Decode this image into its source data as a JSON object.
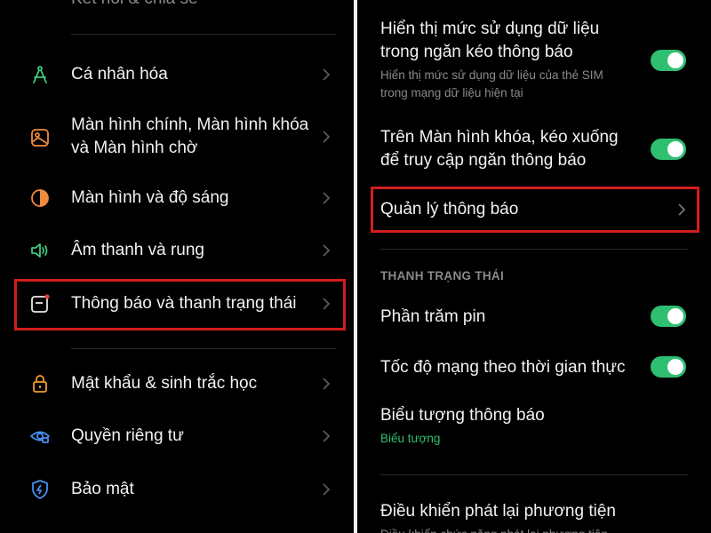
{
  "colors": {
    "accent_green": "#2fbf71",
    "highlight_red": "#d21d1d",
    "text_secondary": "#8a8a8a"
  },
  "left": {
    "top_partial_label": "Kết nối & chia sẻ",
    "items": [
      {
        "icon": "personalize-icon",
        "label": "Cá nhân hóa"
      },
      {
        "icon": "wallpaper-icon",
        "label_line1": "Màn hình chính, Màn hình khóa",
        "label_line2": "và Màn hình chờ"
      },
      {
        "icon": "brightness-icon",
        "label": "Màn hình và độ sáng"
      },
      {
        "icon": "sound-icon",
        "label": "Âm thanh và rung"
      },
      {
        "icon": "notification-icon",
        "label": "Thông báo và thanh trạng thái"
      },
      {
        "icon": "lock-icon",
        "label": "Mật khẩu & sinh trắc học"
      },
      {
        "icon": "privacy-icon",
        "label": "Quyền riêng tư"
      },
      {
        "icon": "shield-icon",
        "label": "Bảo mật"
      }
    ]
  },
  "right": {
    "data_usage": {
      "title_line1": "Hiển thị mức sử dụng dữ liệu",
      "title_line2": "trong ngăn kéo thông báo",
      "sub_line1": "Hiển thị mức sử dụng dữ liệu của thẻ SIM",
      "sub_line2": "trong mạng dữ liệu hiện tại",
      "enabled": true
    },
    "lockscreen_pull": {
      "title_line1": "Trên Màn hình khóa, kéo xuống",
      "title_line2": "để truy cập ngăn thông báo",
      "enabled": true
    },
    "manage_notifications": "Quản lý thông báo",
    "section_status_bar": "THANH TRẠNG THÁI",
    "battery_percent": {
      "title": "Phần trăm pin",
      "enabled": true
    },
    "realtime_speed": {
      "title": "Tốc độ mạng theo thời gian thực",
      "enabled": true
    },
    "notification_icons": {
      "title": "Biểu tượng thông báo",
      "value": "Biểu tượng"
    },
    "media_playback": {
      "title": "Điều khiển phát lại phương tiện",
      "sub_partial": "Điều khiển chức năng phát lại phương tiện"
    }
  }
}
